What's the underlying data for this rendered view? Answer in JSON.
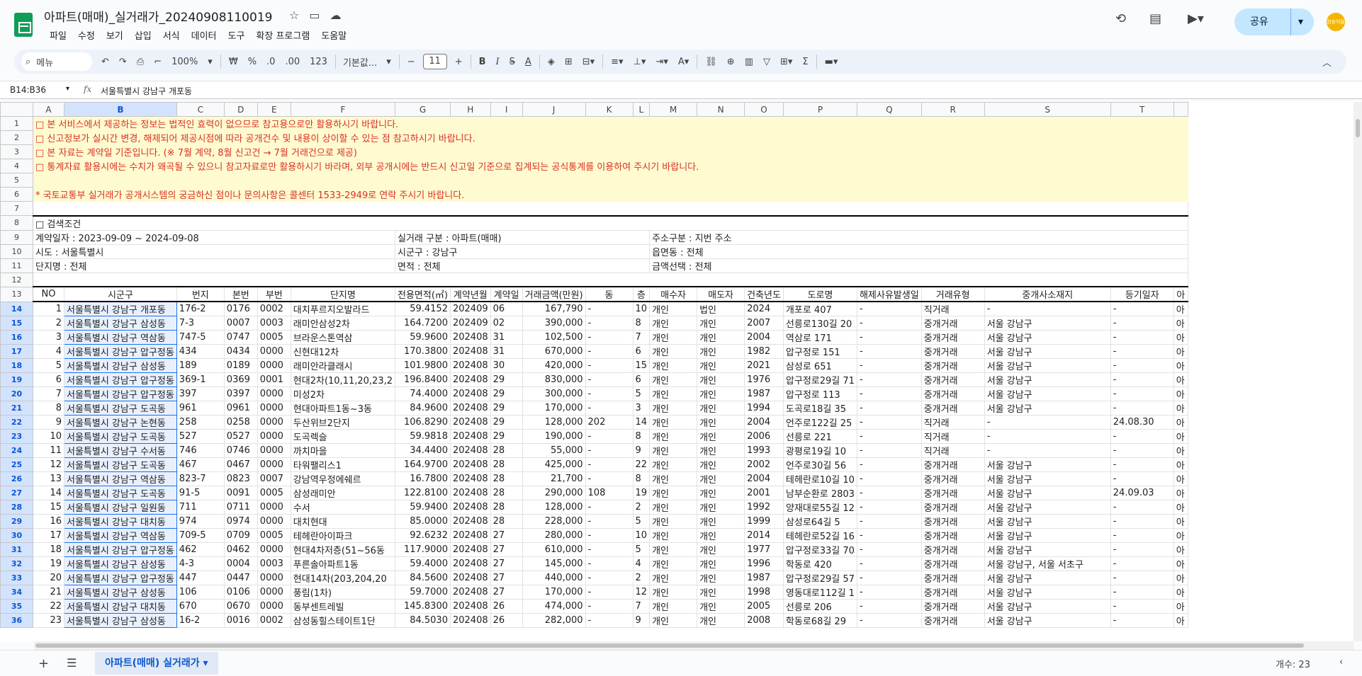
{
  "app": {
    "title": "아파트(매매)_실거래가_20240908110019",
    "menu": [
      "파일",
      "수정",
      "보기",
      "삽입",
      "서식",
      "데이터",
      "도구",
      "확장 프로그램",
      "도움말"
    ],
    "share_label": "공유",
    "avatar_text": "원숭이들"
  },
  "toolbar": {
    "search_label": "메뉴",
    "zoom": "100%",
    "currency": "₩",
    "percent": "%",
    "dec_decrease": ".0",
    "dec_increase": ".00",
    "num_format": "123",
    "font": "기본값...",
    "font_size": "11",
    "bold": "B",
    "italic": "I",
    "strike": "S",
    "text_color": "A"
  },
  "formula_bar": {
    "namebox": "B14:B36",
    "fx": "fx",
    "value": "서울특별시 강남구 개포동"
  },
  "columns": [
    "A",
    "B",
    "C",
    "D",
    "E",
    "F",
    "G",
    "H",
    "I",
    "J",
    "K",
    "L",
    "M",
    "N",
    "O",
    "P",
    "Q",
    "R",
    "S",
    "T"
  ],
  "notices": [
    "□ 본 서비스에서 제공하는 정보는 법적인 효력이 없으므로 참고용으로만 활용하시기 바랍니다.",
    "□ 신고정보가 실시간 변경, 해제되어 제공시점에 따라 공개건수 및 내용이 상이할 수 있는 점 참고하시기 바랍니다.",
    "□ 본 자료는 계약일 기준입니다. (※ 7월 계약, 8월 신고건 → 7월 거래건으로  제공)",
    "□ 통계자료 활용시에는 수치가 왜곡될 수 있으니 참고자료로만 활용하시기  바라며,  외부 공개시에는 반드시 신고일 기준으로 집계되는 공식통계를 이용하여 주시기 바랍니다.",
    "",
    "* 국토교통부 실거래가 공개시스템의 궁금하신 점이나 문의사항은 콜센터 1533-2949로 연락 주시기 바랍니다."
  ],
  "conditions": {
    "heading": "□ 검색조건",
    "r10": [
      "계약일자 : 2023-09-09 ~ 2024-09-08",
      "실거래 구분 : 아파트(매매)",
      "주소구분 : 지번 주소"
    ],
    "r11": [
      "시도 : 서울특별시",
      "시군구 : 강남구",
      "읍면동 : 전체"
    ],
    "r12": [
      "단지명 : 전체",
      "면적 : 전체",
      "금액선택 : 전체"
    ]
  },
  "headers": [
    "NO",
    "시군구",
    "번지",
    "본번",
    "부번",
    "단지명",
    "전용면적(㎡)",
    "계약년월",
    "계약일",
    "거래금액(만원)",
    "동",
    "층",
    "매수자",
    "매도자",
    "건축년도",
    "도로명",
    "해제사유발생일",
    "거래유형",
    "중개사소재지",
    "등기일자",
    "아"
  ],
  "rows": [
    [
      "1",
      "서울특별시 강남구 개포동",
      "176-2",
      "0176",
      "0002",
      "대치푸르지오발라드",
      "59.4152",
      "202409",
      "06",
      "167,790",
      "-",
      "10",
      "개인",
      "법인",
      "2024",
      "개포로 407",
      "-",
      "직거래",
      "-",
      "-",
      "아"
    ],
    [
      "2",
      "서울특별시 강남구 삼성동",
      "7-3",
      "0007",
      "0003",
      "래미안삼성2차",
      "164.7200",
      "202409",
      "02",
      "390,000",
      "-",
      "8",
      "개인",
      "개인",
      "2007",
      "선릉로130길 20",
      "-",
      "중개거래",
      "서울 강남구",
      "-",
      "아"
    ],
    [
      "3",
      "서울특별시 강남구 역삼동",
      "747-5",
      "0747",
      "0005",
      "브라운스톤역삼",
      "59.9600",
      "202408",
      "31",
      "102,500",
      "-",
      "7",
      "개인",
      "개인",
      "2004",
      "역삼로 171",
      "-",
      "중개거래",
      "서울 강남구",
      "-",
      "아"
    ],
    [
      "4",
      "서울특별시 강남구 압구정동",
      "434",
      "0434",
      "0000",
      "신현대12차",
      "170.3800",
      "202408",
      "31",
      "670,000",
      "-",
      "6",
      "개인",
      "개인",
      "1982",
      "압구정로 151",
      "-",
      "중개거래",
      "서울 강남구",
      "-",
      "아"
    ],
    [
      "5",
      "서울특별시 강남구 삼성동",
      "189",
      "0189",
      "0000",
      "래미안라클래시",
      "101.9800",
      "202408",
      "30",
      "420,000",
      "-",
      "15",
      "개인",
      "개인",
      "2021",
      "삼성로 651",
      "-",
      "중개거래",
      "서울 강남구",
      "-",
      "아"
    ],
    [
      "6",
      "서울특별시 강남구 압구정동",
      "369-1",
      "0369",
      "0001",
      "현대2차(10,11,20,23,2",
      "196.8400",
      "202408",
      "29",
      "830,000",
      "-",
      "6",
      "개인",
      "개인",
      "1976",
      "압구정로29길 71",
      "-",
      "중개거래",
      "서울 강남구",
      "-",
      "아"
    ],
    [
      "7",
      "서울특별시 강남구 압구정동",
      "397",
      "0397",
      "0000",
      "미성2차",
      "74.4000",
      "202408",
      "29",
      "300,000",
      "-",
      "5",
      "개인",
      "개인",
      "1987",
      "압구정로 113",
      "-",
      "중개거래",
      "서울 강남구",
      "-",
      "아"
    ],
    [
      "8",
      "서울특별시 강남구 도곡동",
      "961",
      "0961",
      "0000",
      "현대아파트1동~3동",
      "84.9600",
      "202408",
      "29",
      "170,000",
      "-",
      "3",
      "개인",
      "개인",
      "1994",
      "도곡로18길 35",
      "-",
      "중개거래",
      "서울 강남구",
      "-",
      "아"
    ],
    [
      "9",
      "서울특별시 강남구 논현동",
      "258",
      "0258",
      "0000",
      "두산위브2단지",
      "106.8290",
      "202408",
      "29",
      "128,000",
      "202",
      "14",
      "개인",
      "개인",
      "2004",
      "언주로122길 25",
      "-",
      "직거래",
      "-",
      "24.08.30",
      "아"
    ],
    [
      "10",
      "서울특별시 강남구 도곡동",
      "527",
      "0527",
      "0000",
      "도곡렉슬",
      "59.9818",
      "202408",
      "29",
      "190,000",
      "-",
      "8",
      "개인",
      "개인",
      "2006",
      "선릉로 221",
      "-",
      "직거래",
      "-",
      "-",
      "아"
    ],
    [
      "11",
      "서울특별시 강남구 수서동",
      "746",
      "0746",
      "0000",
      "까치마을",
      "34.4400",
      "202408",
      "28",
      "55,000",
      "-",
      "9",
      "개인",
      "개인",
      "1993",
      "광평로19길 10",
      "-",
      "직거래",
      "-",
      "-",
      "아"
    ],
    [
      "12",
      "서울특별시 강남구 도곡동",
      "467",
      "0467",
      "0000",
      "타워팰리스1",
      "164.9700",
      "202408",
      "28",
      "425,000",
      "-",
      "22",
      "개인",
      "개인",
      "2002",
      "언주로30길 56",
      "-",
      "중개거래",
      "서울 강남구",
      "-",
      "아"
    ],
    [
      "13",
      "서울특별시 강남구 역삼동",
      "823-7",
      "0823",
      "0007",
      "강남역우정에쉐르",
      "16.7800",
      "202408",
      "28",
      "21,700",
      "-",
      "8",
      "개인",
      "개인",
      "2004",
      "테헤란로10길 10",
      "-",
      "중개거래",
      "서울 강남구",
      "-",
      "아"
    ],
    [
      "14",
      "서울특별시 강남구 도곡동",
      "91-5",
      "0091",
      "0005",
      "삼성래미안",
      "122.8100",
      "202408",
      "28",
      "290,000",
      "108",
      "19",
      "개인",
      "개인",
      "2001",
      "남부순환로 2803",
      "-",
      "중개거래",
      "서울 강남구",
      "24.09.03",
      "아"
    ],
    [
      "15",
      "서울특별시 강남구 일원동",
      "711",
      "0711",
      "0000",
      "수서",
      "59.9400",
      "202408",
      "28",
      "128,000",
      "-",
      "2",
      "개인",
      "개인",
      "1992",
      "양재대로55길 12",
      "-",
      "중개거래",
      "서울 강남구",
      "-",
      "아"
    ],
    [
      "16",
      "서울특별시 강남구 대치동",
      "974",
      "0974",
      "0000",
      "대치현대",
      "85.0000",
      "202408",
      "28",
      "228,000",
      "-",
      "5",
      "개인",
      "개인",
      "1999",
      "삼성로64길 5",
      "-",
      "중개거래",
      "서울 강남구",
      "-",
      "아"
    ],
    [
      "17",
      "서울특별시 강남구 역삼동",
      "709-5",
      "0709",
      "0005",
      "테헤란아이파크",
      "92.6232",
      "202408",
      "27",
      "280,000",
      "-",
      "10",
      "개인",
      "개인",
      "2014",
      "테헤란로52길 16",
      "-",
      "중개거래",
      "서울 강남구",
      "-",
      "아"
    ],
    [
      "18",
      "서울특별시 강남구 압구정동",
      "462",
      "0462",
      "0000",
      "현대4차저층(51~56동",
      "117.9000",
      "202408",
      "27",
      "610,000",
      "-",
      "5",
      "개인",
      "개인",
      "1977",
      "압구정로33길 70",
      "-",
      "중개거래",
      "서울 강남구",
      "-",
      "아"
    ],
    [
      "19",
      "서울특별시 강남구 삼성동",
      "4-3",
      "0004",
      "0003",
      "푸른솔아파트1동",
      "59.4000",
      "202408",
      "27",
      "145,000",
      "-",
      "4",
      "개인",
      "개인",
      "1996",
      "학동로 420",
      "-",
      "중개거래",
      "서울 강남구, 서울 서초구",
      "-",
      "아"
    ],
    [
      "20",
      "서울특별시 강남구 압구정동",
      "447",
      "0447",
      "0000",
      "현대14차(203,204,20",
      "84.5600",
      "202408",
      "27",
      "440,000",
      "-",
      "2",
      "개인",
      "개인",
      "1987",
      "압구정로29길 57",
      "-",
      "중개거래",
      "서울 강남구",
      "-",
      "아"
    ],
    [
      "21",
      "서울특별시 강남구 삼성동",
      "106",
      "0106",
      "0000",
      "풍림(1차)",
      "59.7000",
      "202408",
      "27",
      "170,000",
      "-",
      "12",
      "개인",
      "개인",
      "1998",
      "영동대로112길 1",
      "-",
      "중개거래",
      "서울 강남구",
      "-",
      "아"
    ],
    [
      "22",
      "서울특별시 강남구 대치동",
      "670",
      "0670",
      "0000",
      "동부센트레빌",
      "145.8300",
      "202408",
      "26",
      "474,000",
      "-",
      "7",
      "개인",
      "개인",
      "2005",
      "선릉로 206",
      "-",
      "중개거래",
      "서울 강남구",
      "-",
      "아"
    ],
    [
      "23",
      "서울특별시 강남구 삼성동",
      "16-2",
      "0016",
      "0002",
      "삼성동힐스테이트1단",
      "84.5030",
      "202408",
      "26",
      "282,000",
      "-",
      "9",
      "개인",
      "개인",
      "2008",
      "학동로68길 29",
      "-",
      "중개거래",
      "서울 강남구",
      "-",
      "아"
    ]
  ],
  "tabs": {
    "active_sheet": "아파트(매매) 실거래가",
    "status": "개수: 23"
  }
}
